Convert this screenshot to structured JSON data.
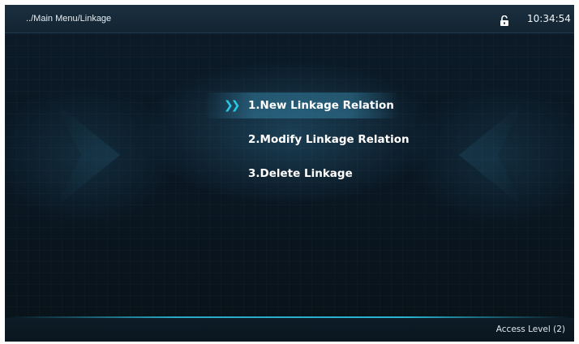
{
  "header": {
    "breadcrumb": "../Main Menu/Linkage",
    "lock_icon": "unlocked-padlock-icon",
    "time": "10:34:54"
  },
  "menu": {
    "selected_index": 0,
    "selector_icon": "double-chevron-right-icon",
    "selector_glyph": "❯❯",
    "items": [
      {
        "label": "1.New Linkage Relation"
      },
      {
        "label": "2.Modify Linkage Relation"
      },
      {
        "label": "3.Delete Linkage"
      }
    ]
  },
  "footer": {
    "access_level": "Access Level (2)"
  },
  "colors": {
    "accent": "#29c7e8",
    "selected_bg": "#347d9e",
    "background": "#0a1723"
  }
}
